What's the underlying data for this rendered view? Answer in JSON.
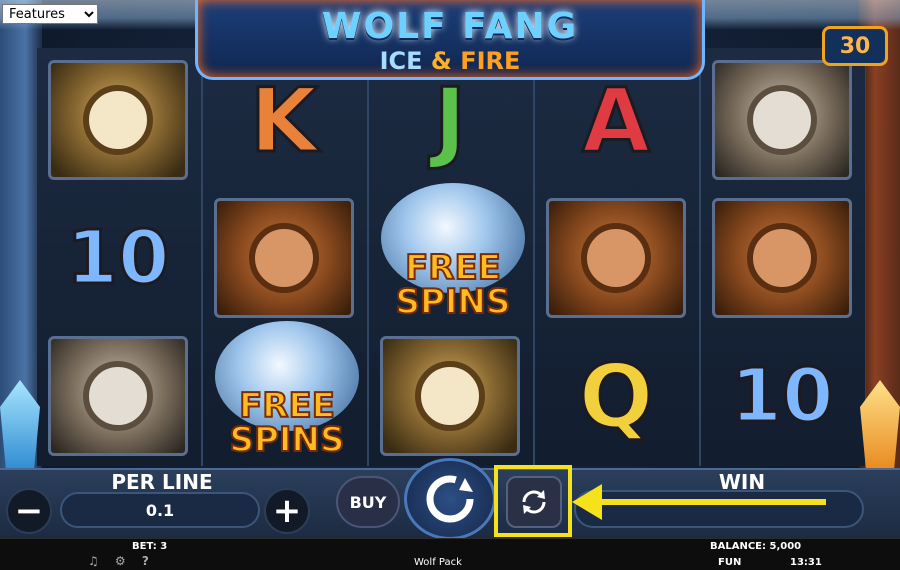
{
  "browser": {
    "select_value": "Features",
    "select_options": [
      "Features"
    ]
  },
  "game": {
    "title_line1": "WOLF FANG",
    "subtitle_ice": "ICE",
    "subtitle_amp": "&",
    "subtitle_fire": "FIRE",
    "paylines": "30"
  },
  "reels": [
    [
      "hawk",
      "10",
      "deer"
    ],
    [
      "K",
      "bear",
      "free_spins"
    ],
    [
      "J",
      "free_spins",
      "hawk"
    ],
    [
      "A",
      "bear",
      "Q"
    ],
    [
      "deer",
      "bear",
      "10"
    ]
  ],
  "symbol_text": {
    "free_spins_line1": "FREE",
    "free_spins_line2": "SPINS"
  },
  "controls": {
    "per_line_label": "PER LINE",
    "per_line_value": "0.1",
    "minus": "−",
    "plus": "+",
    "buy_label": "BUY",
    "win_label": "WIN"
  },
  "status": {
    "bet": "BET: 3",
    "balance": "BALANCE: 5,000",
    "mode": "FUN",
    "time": "13:31",
    "game_name": "Wolf Pack"
  },
  "colors": {
    "highlight": "#f5e21c",
    "accent_fire": "#ffa020",
    "accent_ice": "#6ed0ff"
  },
  "icons": [
    "minus-icon",
    "plus-icon",
    "spin-icon",
    "autoplay-icon",
    "arrow-icon",
    "speaker-icon",
    "settings-icon"
  ]
}
